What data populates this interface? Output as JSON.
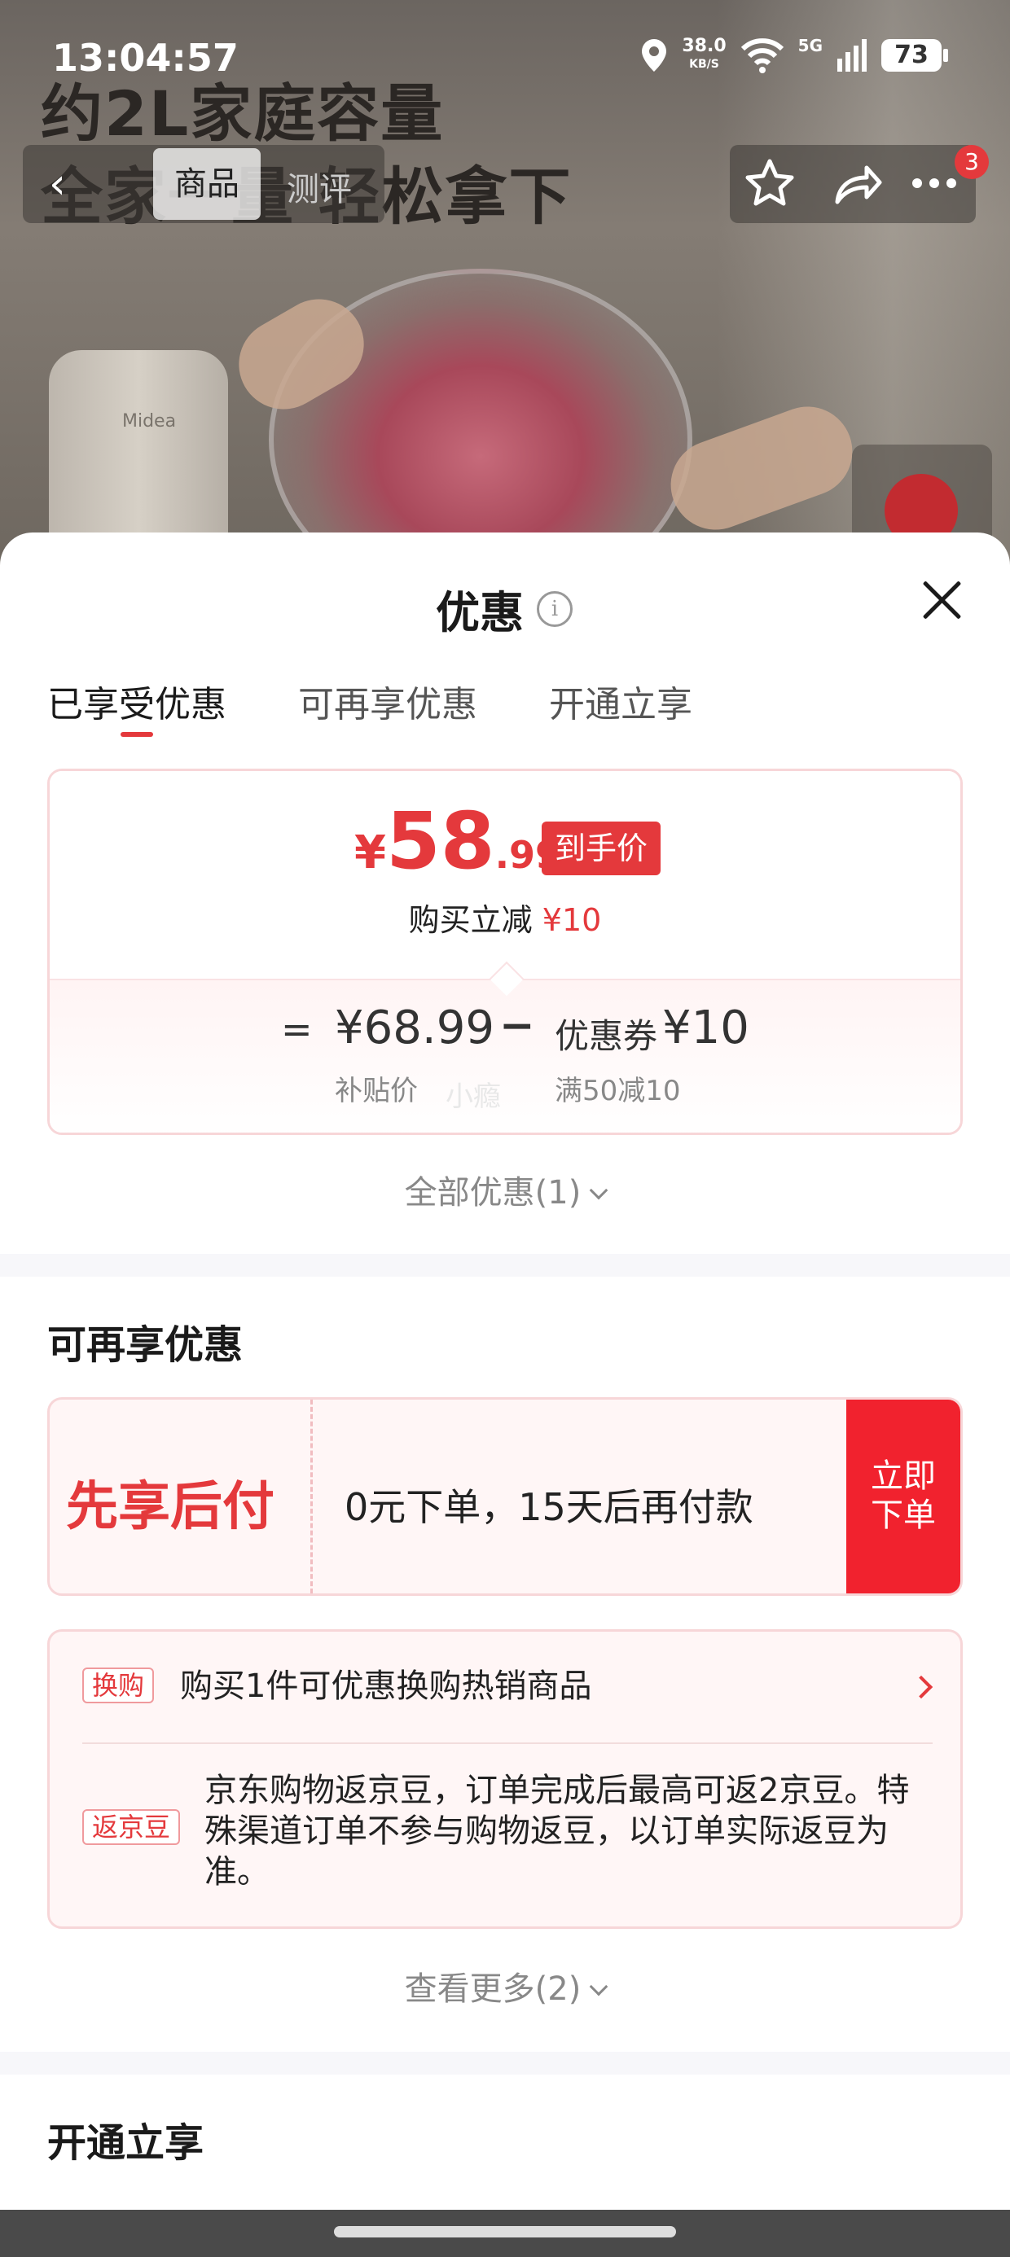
{
  "status_bar": {
    "time": "13:04:57",
    "net_speed": "38.0",
    "net_speed_unit": "KB/S",
    "network_type": "5G",
    "battery": "73"
  },
  "hero": {
    "headline_1": "约2L家庭容量",
    "headline_2": "全家一量 轻松拿下",
    "brand_on_product": "Midea"
  },
  "nav": {
    "tabs": [
      "商品",
      "测评"
    ],
    "active_tab": "商品",
    "cart_badge": "3"
  },
  "sheet": {
    "title": "优惠",
    "tabs": [
      {
        "label": "已享受优惠",
        "active": true
      },
      {
        "label": "可再享优惠",
        "active": false
      },
      {
        "label": "开通立享",
        "active": false
      }
    ],
    "price_card": {
      "currency": "¥",
      "price_int": "58",
      "price_dec": ".99",
      "price_tag": "到手价",
      "discount_prefix": "购买立减",
      "discount_value": "¥10",
      "equals": "=",
      "base_price": "¥68.99",
      "base_label": "补贴价",
      "minus": "−",
      "coupon_name": "优惠券",
      "coupon_value": "¥10",
      "coupon_rule": "满50减10",
      "watermark": "小瘾"
    },
    "all_discounts_link": "全部优惠(1)",
    "section_more": {
      "title": "可再享优惠",
      "pay_later": {
        "name": "先享后付",
        "desc": "0元下单，15天后再付款",
        "button_line1": "立即",
        "button_line2": "下单"
      },
      "perks": [
        {
          "tag": "换购",
          "text": "购买1件可优惠换购热销商品"
        },
        {
          "tag": "返京豆",
          "text": "京东购物返京豆，订单完成后最高可返2京豆。特殊渠道订单不参与购物返豆，以订单实际返豆为准。"
        }
      ],
      "view_more_link": "查看更多(2)"
    },
    "section_join": {
      "title": "开通立享"
    }
  },
  "colors": {
    "accent_red": "#e4393c",
    "button_red": "#f1222e"
  },
  "icons": [
    "location-icon",
    "wifi-icon",
    "signal-icon",
    "battery-icon",
    "back-icon",
    "star-icon",
    "share-icon",
    "more-icon",
    "info-icon",
    "close-icon",
    "chevron-down-icon",
    "chevron-right-icon"
  ]
}
